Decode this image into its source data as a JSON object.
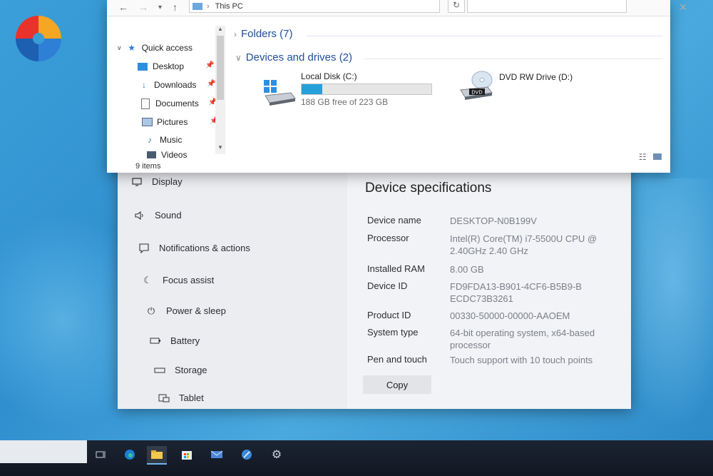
{
  "explorer": {
    "breadcrumb": "This PC",
    "quick_access": {
      "label": "Quick access",
      "items": [
        {
          "label": "Desktop",
          "icon": "desktop-folder-icon"
        },
        {
          "label": "Downloads",
          "icon": "downloads-folder-icon"
        },
        {
          "label": "Documents",
          "icon": "documents-folder-icon"
        },
        {
          "label": "Pictures",
          "icon": "pictures-folder-icon"
        },
        {
          "label": "Music",
          "icon": "music-folder-icon"
        },
        {
          "label": "Videos",
          "icon": "videos-folder-icon"
        }
      ]
    },
    "folders_group": "Folders (7)",
    "devices_group": "Devices and drives (2)",
    "drives": [
      {
        "name": "Local Disk (C:)",
        "free_text": "188 GB free of 223 GB",
        "used_fraction": 0.157
      },
      {
        "name": "DVD RW Drive (D:)",
        "badge": "DVD"
      }
    ],
    "status": "9 items"
  },
  "settings": {
    "nav": [
      {
        "label": "Display",
        "icon": "monitor-icon"
      },
      {
        "label": "Sound",
        "icon": "speaker-icon"
      },
      {
        "label": "Notifications & actions",
        "icon": "notification-icon"
      },
      {
        "label": "Focus assist",
        "icon": "moon-icon"
      },
      {
        "label": "Power & sleep",
        "icon": "power-icon"
      },
      {
        "label": "Battery",
        "icon": "battery-icon"
      },
      {
        "label": "Storage",
        "icon": "storage-icon"
      },
      {
        "label": "Tablet",
        "icon": "tablet-icon"
      }
    ],
    "spec_title": "Device specifications",
    "specs": [
      {
        "label": "Device name",
        "value": "DESKTOP-N0B199V"
      },
      {
        "label": "Processor",
        "value": "Intel(R) Core(TM) i7-5500U CPU @ 2.40GHz   2.40 GHz"
      },
      {
        "label": "Installed RAM",
        "value": "8.00 GB"
      },
      {
        "label": "Device ID",
        "value": "FD9FDA13-B901-4CF6-B5B9-BECDC73B3261"
      },
      {
        "label": "Product ID",
        "value": "00330-50000-00000-AAOEM"
      },
      {
        "label": "System type",
        "value": "64-bit operating system, x64-based processor"
      },
      {
        "label": "Pen and touch",
        "value": "Touch support with 10 touch points"
      }
    ],
    "copy_label": "Copy"
  },
  "colors": {
    "accent": "#26a0da",
    "group_header": "#1e4f9a",
    "desktop": "#3b9fd8"
  }
}
